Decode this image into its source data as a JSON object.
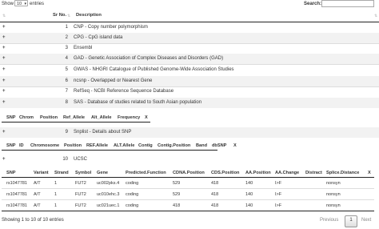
{
  "controls": {
    "show_label": "Show",
    "length_value": "10",
    "entries_label": "entries",
    "search_label": "Search:",
    "search_value": ""
  },
  "main_table": {
    "col_srno": "Sr No.",
    "col_desc": "Description",
    "expand_glyph": "+",
    "rows": [
      {
        "sr": "1",
        "desc": "CNP - Copy number polymorphism"
      },
      {
        "sr": "2",
        "desc": "CPG - CpG island data"
      },
      {
        "sr": "3",
        "desc": "Ensembl"
      },
      {
        "sr": "4",
        "desc": "GAD - Genetic Association of Complex Diseases and Disorders (GAD)"
      },
      {
        "sr": "5",
        "desc": "GWAS - NHGRI Catalogue of Published Genome-Wide Association Studies"
      },
      {
        "sr": "6",
        "desc": "ncsnp - Overlapped or Nearest Gene"
      },
      {
        "sr": "7",
        "desc": "RefSeq - NCBI Reference Sequence Database"
      },
      {
        "sr": "8",
        "desc": "SAS - Database of studies related to South Asian population"
      },
      {
        "sr": "9",
        "desc": "Snplist - Details about SNP"
      },
      {
        "sr": "10",
        "desc": "UCSC"
      }
    ]
  },
  "sas_subtable": {
    "headers": [
      "SNP",
      "Chrom",
      "Position",
      "Ref_Allele",
      "Alt_Allele",
      "Frequency",
      "X"
    ]
  },
  "snplist_subtable": {
    "headers": [
      "SNP",
      "ID",
      "Chromosome",
      "Position",
      "REF.Allele",
      "ALT.Allele",
      "Contig",
      "Contig.Position",
      "Band",
      "dbSNP",
      "X"
    ]
  },
  "ucsc_subtable": {
    "headers": [
      "SNP",
      "Variant",
      "Strand",
      "Symbol",
      "Gene",
      "Predicted.Function",
      "CDNA.Position",
      "CDS.Position",
      "AA.Position",
      "AA.Change",
      "Distract",
      "Splice.Distance",
      "X"
    ],
    "rows": [
      [
        "rs1047781",
        "A/T",
        "1",
        "FUT2",
        "uc002pks.4",
        "coding",
        "529",
        "418",
        "140",
        "I>F",
        "",
        "nonsyn"
      ],
      [
        "rs1047781",
        "A/T",
        "1",
        "FUT2",
        "uc010ehc.3",
        "coding",
        "529",
        "418",
        "140",
        "I>F",
        "",
        "nonsyn"
      ],
      [
        "rs1047781",
        "A/T",
        "1",
        "FUT2",
        "uc021uec.1",
        "coding",
        "418",
        "418",
        "140",
        "I>F",
        "",
        "nonsyn"
      ]
    ]
  },
  "footer": {
    "info": "Showing 1 to 10 of 10 entries",
    "prev": "Previous",
    "page": "1",
    "next": "Next"
  }
}
